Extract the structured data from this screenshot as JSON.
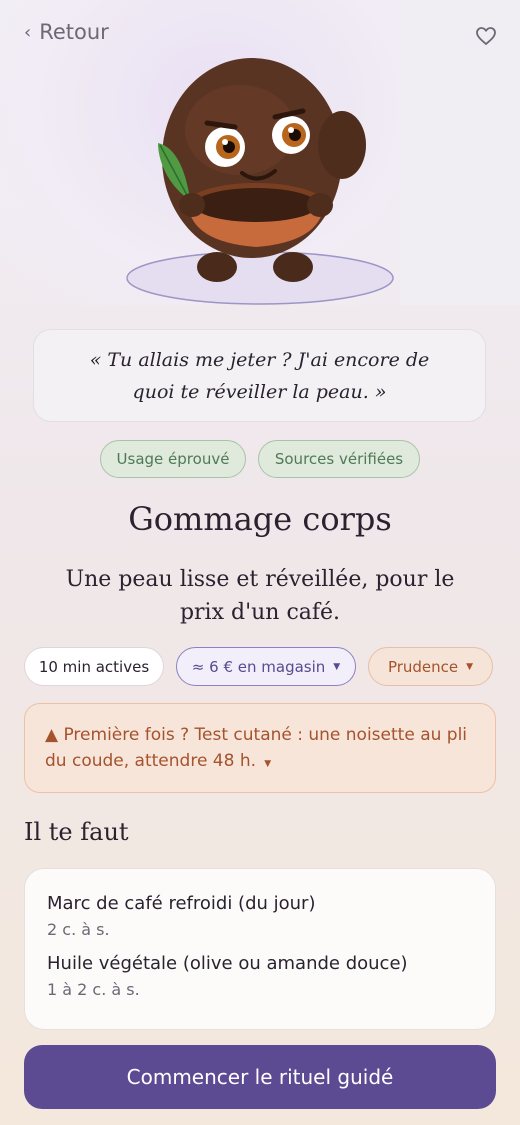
{
  "nav": {
    "back_label": "Retour"
  },
  "quote": "« Tu allais me jeter ? J'ai encore de quoi te réveiller la peau. »",
  "badges": [
    "Usage éprouvé",
    "Sources vérifiées"
  ],
  "title": "Gommage corps",
  "subtitle": "Une peau lisse et réveillée, pour le prix d'un café.",
  "chips": {
    "time": "10 min actives",
    "cost": "≈ 6 € en magasin",
    "caution": "Prudence"
  },
  "warning": "▲ Première fois ? Test cutané : une noisette au pli du coude, attendre 48 h.",
  "section_title": "Il te faut",
  "ingredients": [
    {
      "name": "Marc de café refroidi (du jour)",
      "qty": "2 c. à s."
    },
    {
      "name": "Huile végétale (olive ou amande douce)",
      "qty": "1 à 2 c. à s."
    }
  ],
  "cta_label": "Commencer le rituel guidé",
  "colors": {
    "accent": "#5c4b93",
    "success": "#4f7a55",
    "warning": "#a5532c"
  }
}
